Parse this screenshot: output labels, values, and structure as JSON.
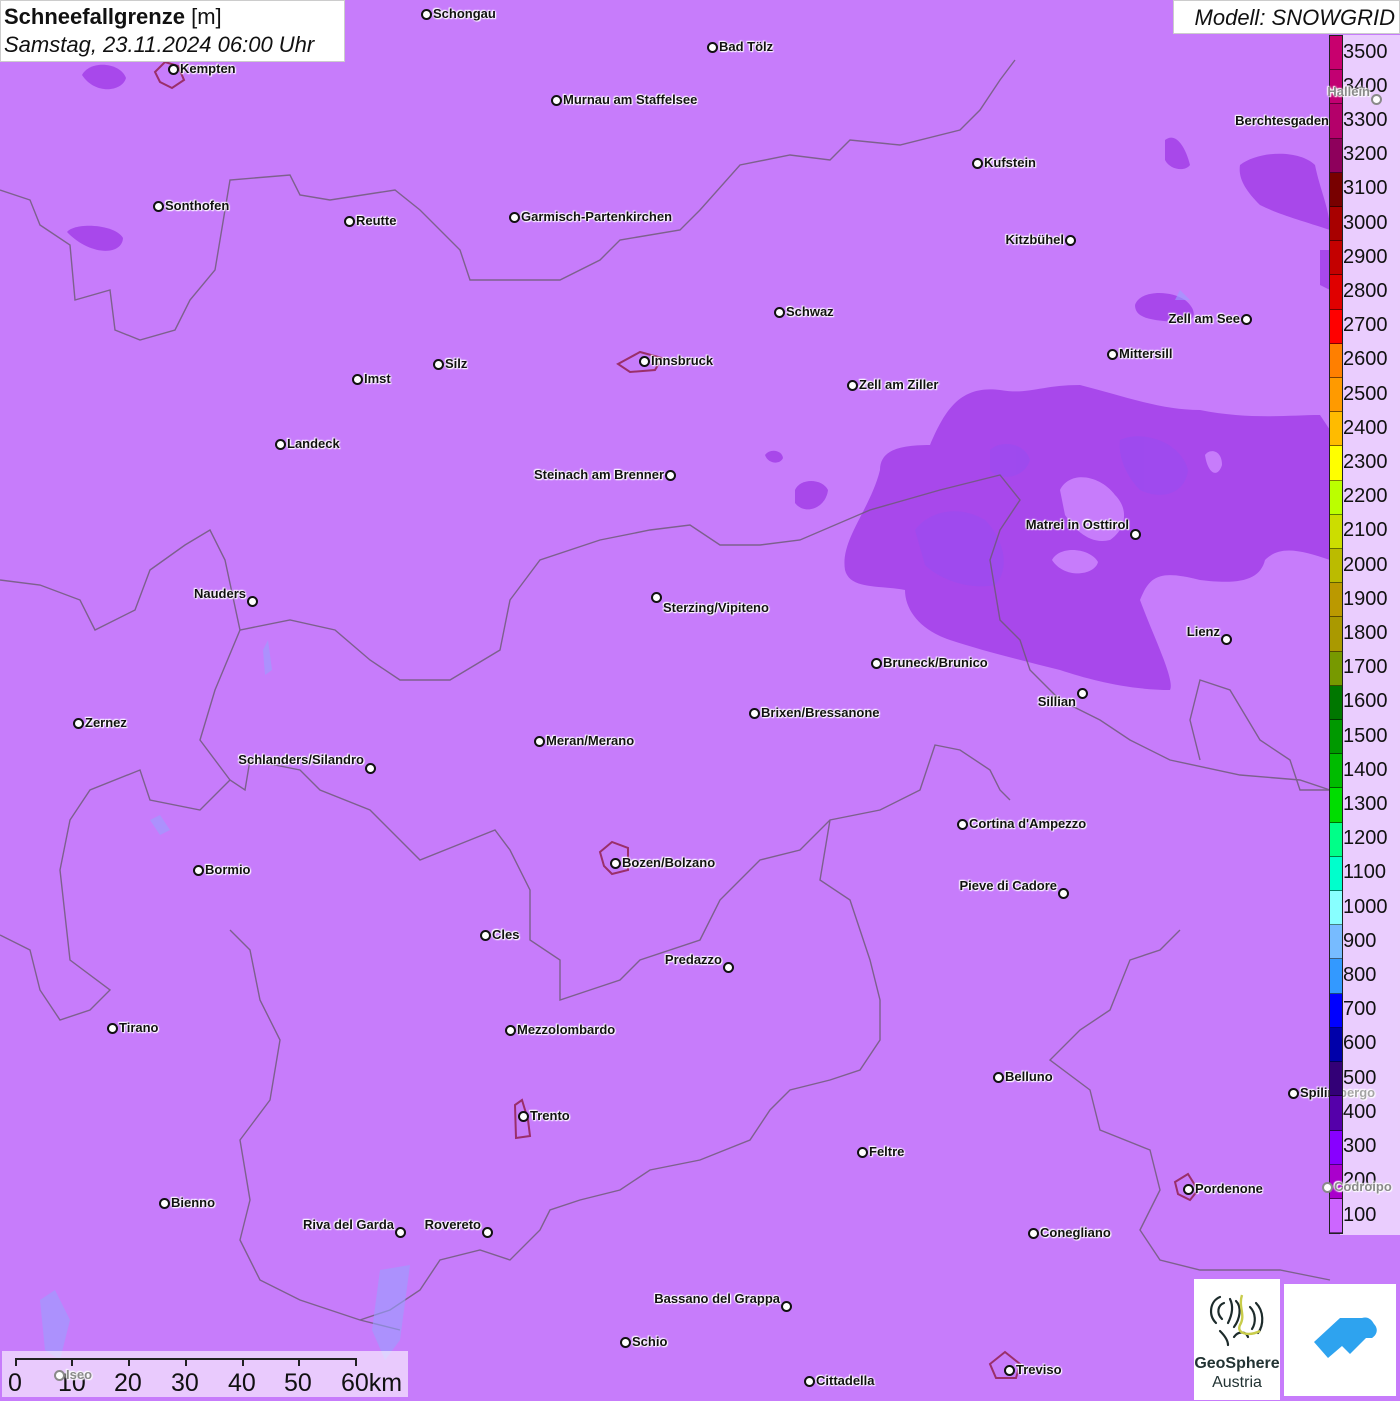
{
  "header": {
    "title": "Schneefallgrenze",
    "unit": "[m]",
    "datetime": "Samstag, 23.11.2024 06:00 Uhr",
    "model": "Modell: SNOWGRID"
  },
  "legend": {
    "labels": [
      "3500",
      "3400",
      "3300",
      "3200",
      "3100",
      "3000",
      "2900",
      "2800",
      "2700",
      "2600",
      "2500",
      "2400",
      "2300",
      "2200",
      "2100",
      "2000",
      "1900",
      "1800",
      "1700",
      "1600",
      "1500",
      "1400",
      "1300",
      "1200",
      "1100",
      "1000",
      "900",
      "800",
      "700",
      "600",
      "500",
      "400",
      "300",
      "200",
      "100"
    ],
    "colors": [
      "#c8006e",
      "#c20072",
      "#b4006a",
      "#8e005c",
      "#780000",
      "#a80000",
      "#c40000",
      "#e00000",
      "#ff0000",
      "#ff7f00",
      "#ff9a00",
      "#ffbb00",
      "#ffff00",
      "#bbff00",
      "#ccdd00",
      "#bbbb00",
      "#bb9900",
      "#aa9900",
      "#779900",
      "#007700",
      "#009900",
      "#00bb00",
      "#00dd00",
      "#00ff88",
      "#00ffcc",
      "#88ffff",
      "#77bbff",
      "#3399ff",
      "#0000ff",
      "#0000aa",
      "#330077",
      "#5500aa",
      "#8800ff",
      "#aa00cc",
      "#cc66ff"
    ]
  },
  "map": {
    "background_color": "#c77cfb",
    "region_color": "#a746ea",
    "cities": [
      "Schongau",
      "Kempten",
      "Bad Tölz",
      "Murnau am Staffelsee",
      "Kufstein",
      "Berchtesgaden",
      "Hallein",
      "Sonthofen",
      "Reutte",
      "Garmisch-Partenkirchen",
      "Kitzbühel",
      "Schwaz",
      "Zell am See",
      "Mittersill",
      "Innsbruck",
      "Silz",
      "Imst",
      "Zell am Ziller",
      "Landeck",
      "Steinach am Brenner",
      "Matrei in Osttirol",
      "Nauders",
      "Sterzing/Vipiteno",
      "Lienz",
      "Bruneck/Brunico",
      "Sillian",
      "Brixen/Bressanone",
      "Zernez",
      "Meran/Merano",
      "Schlanders/Silandro",
      "Cortina d'Ampezzo",
      "Bozen/Bolzano",
      "Bormio",
      "Pieve di Cadore",
      "Cles",
      "Predazzo",
      "Tirano",
      "Mezzolombardo",
      "Belluno",
      "Spilimbergo",
      "Trento",
      "Feltre",
      "Pordenone",
      "Codroipo",
      "Bienno",
      "Riva del Garda",
      "Rovereto",
      "Conegliano",
      "Bassano del Grappa",
      "Schio",
      "Treviso",
      "Cittadella",
      "Iseo"
    ]
  },
  "scale": {
    "ticks": [
      "0",
      "10",
      "20",
      "30",
      "40",
      "50",
      "60km"
    ]
  },
  "logos": {
    "geosphere_line1": "GeoSphere",
    "geosphere_line2": "Austria"
  }
}
